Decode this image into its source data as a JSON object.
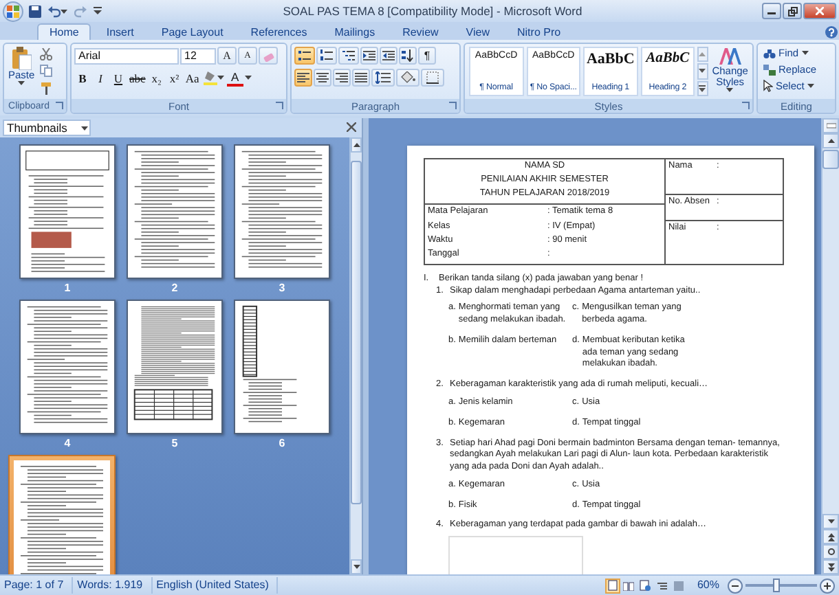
{
  "window": {
    "title": "SOAL PAS TEMA 8 [Compatibility Mode] - Microsoft Word"
  },
  "tabs": [
    {
      "label": "Home",
      "selected": true
    },
    {
      "label": "Insert",
      "selected": false
    },
    {
      "label": "Page Layout",
      "selected": false
    },
    {
      "label": "References",
      "selected": false
    },
    {
      "label": "Mailings",
      "selected": false
    },
    {
      "label": "Review",
      "selected": false
    },
    {
      "label": "View",
      "selected": false
    },
    {
      "label": "Nitro Pro",
      "selected": false
    }
  ],
  "ribbon": {
    "clipboard": {
      "label": "Clipboard",
      "paste": "Paste"
    },
    "font": {
      "label": "Font",
      "name": "Arial",
      "size": "12",
      "grow": "A",
      "shrink": "A",
      "font_color": "A",
      "format_buttons": [
        "B",
        "I",
        "U",
        "abc",
        "x₂",
        "x²",
        "Aa"
      ]
    },
    "paragraph": {
      "label": "Paragraph",
      "show_marks": "¶",
      "list_buttons": [
        {
          "kind": "bullets",
          "on": true
        },
        {
          "kind": "numbering",
          "on": false
        },
        {
          "kind": "multilevel",
          "on": false
        }
      ],
      "alignments": [
        {
          "kind": "left",
          "selected": true
        },
        {
          "kind": "center",
          "selected": false
        },
        {
          "kind": "right",
          "selected": false
        },
        {
          "kind": "justify",
          "selected": false
        }
      ]
    },
    "styles": {
      "label": "Styles",
      "change": "Change Styles",
      "items": [
        {
          "preview": "AaBbCcD",
          "name": "¶ Normal",
          "kind": "body"
        },
        {
          "preview": "AaBbCcD",
          "name": "¶ No Spaci...",
          "kind": "body"
        },
        {
          "preview": "AaBbC",
          "name": "Heading 1",
          "kind": "heading1"
        },
        {
          "preview": "AaBbC",
          "name": "Heading 2",
          "kind": "heading2"
        }
      ]
    },
    "editing": {
      "label": "Editing",
      "items": [
        {
          "kind": "find",
          "label": "Find"
        },
        {
          "kind": "replace",
          "label": "Replace"
        },
        {
          "kind": "select",
          "label": "Select"
        }
      ]
    }
  },
  "thumbnails": {
    "title": "Thumbnails",
    "pages": [
      {
        "number": "1",
        "selected": false,
        "kind": "cover"
      },
      {
        "number": "2",
        "selected": false,
        "kind": "text"
      },
      {
        "number": "3",
        "selected": false,
        "kind": "text"
      },
      {
        "number": "4",
        "selected": false,
        "kind": "text"
      },
      {
        "number": "5",
        "selected": false,
        "kind": "table"
      },
      {
        "number": "6",
        "selected": false,
        "kind": "grid"
      },
      {
        "selected": true,
        "kind": "text"
      }
    ]
  },
  "document": {
    "header": {
      "title_lines": [
        "NAMA SD",
        "PENILAIAN AKHIR SEMESTER",
        "TAHUN PELAJARAN 2018/2019"
      ],
      "info": [
        {
          "label": "Mata Pelajaran",
          "value": ": Tematik tema 8"
        },
        {
          "label": "Kelas",
          "value": ": IV (Empat)"
        },
        {
          "label": "Waktu",
          "value": ": 90 menit"
        },
        {
          "label": "Tanggal",
          "value": ":"
        }
      ],
      "fields": [
        {
          "label": "Nama",
          "value": ":"
        },
        {
          "label": "No. Absen",
          "value": ":"
        },
        {
          "label": "Nilai",
          "value": ":"
        }
      ]
    },
    "instruction": {
      "number": "I.",
      "text": "Berikan tanda silang (x) pada jawaban yang benar !"
    },
    "questions": [
      {
        "number": "1.",
        "kind": "choice",
        "text": "Sikap dalam menghadapi perbedaan Agama antarteman yaitu..",
        "options": [
          {
            "letter": "a.",
            "text": "Menghormati teman yang sedang melakukan ibadah."
          },
          {
            "letter": "c.",
            "text": "Mengusilkan teman yang berbeda agama."
          },
          {
            "letter": "b.",
            "text": "Memilih dalam berteman"
          },
          {
            "letter": "d.",
            "text": "Membuat keributan ketika ada teman yang sedang melakukan ibadah."
          }
        ]
      },
      {
        "number": "2.",
        "kind": "choice",
        "text": "Keberagaman karakteristik yang ada di rumah meliputi, kecuali…",
        "options": [
          {
            "letter": "a.",
            "text": "Jenis kelamin"
          },
          {
            "letter": "c.",
            "text": "Usia"
          },
          {
            "letter": "b.",
            "text": "Kegemaran"
          },
          {
            "letter": "d.",
            "text": "Tempat tinggal"
          }
        ]
      },
      {
        "number": "3.",
        "kind": "choice",
        "text": "Setiap hari Ahad pagi Doni bermain badminton Bersama dengan teman- temannya, sedangkan Ayah melakukan Lari pagi di Alun- laun kota. Perbedaan karakteristik yang ada pada Doni dan Ayah adalah..",
        "options": [
          {
            "letter": "a.",
            "text": "Kegemaran"
          },
          {
            "letter": "c.",
            "text": "Usia"
          },
          {
            "letter": "b.",
            "text": "Fisik"
          },
          {
            "letter": "d.",
            "text": "Tempat tinggal"
          }
        ]
      },
      {
        "number": "4.",
        "kind": "picture",
        "text": "Keberagaman yang terdapat pada gambar di bawah ini adalah…"
      }
    ]
  },
  "status_bar": {
    "page": "Page: 1 of 7",
    "words": "Words: 1.919",
    "language": "English (United States)",
    "zoom": "60%",
    "zoom_slider": {
      "level": 0.42
    }
  }
}
